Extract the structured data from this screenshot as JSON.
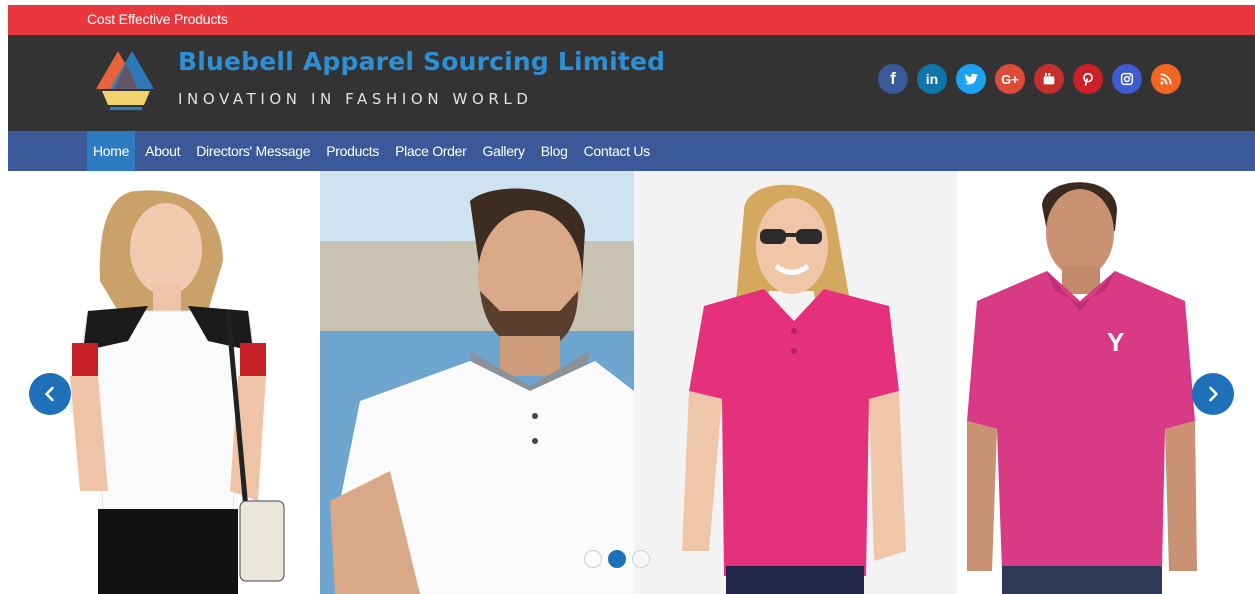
{
  "topbar": {
    "text": "Cost Effective Products"
  },
  "brand": {
    "title": "Bluebell Apparel Sourcing Limited",
    "tagline": "INOVATION IN FASHION WORLD"
  },
  "social": [
    {
      "name": "facebook-icon",
      "glyph": "f",
      "color": "#3b5998"
    },
    {
      "name": "linkedin-icon",
      "glyph": "in",
      "color": "#0e76a8"
    },
    {
      "name": "twitter-icon",
      "glyph": "",
      "color": "#1da1f2"
    },
    {
      "name": "google-plus-icon",
      "glyph": "G+",
      "color": "#dd4b39"
    },
    {
      "name": "youtube-icon",
      "glyph": "",
      "color": "#c4302b"
    },
    {
      "name": "pinterest-icon",
      "glyph": "",
      "color": "#cb2027"
    },
    {
      "name": "instagram-icon",
      "glyph": "",
      "color": "#3f5bd0"
    },
    {
      "name": "rss-icon",
      "glyph": "",
      "color": "#f26522"
    }
  ],
  "nav": {
    "items": [
      "Home",
      "About",
      "Directors' Message",
      "Products",
      "Place Order",
      "Gallery",
      "Blog",
      "Contact Us"
    ],
    "active_index": 0
  },
  "slider": {
    "slides_count": 3,
    "active_slide": 2
  },
  "colors": {
    "topbar": "#e8383d",
    "header": "#333333",
    "navbar": "#3b5998",
    "accent": "#2d8fd5"
  }
}
